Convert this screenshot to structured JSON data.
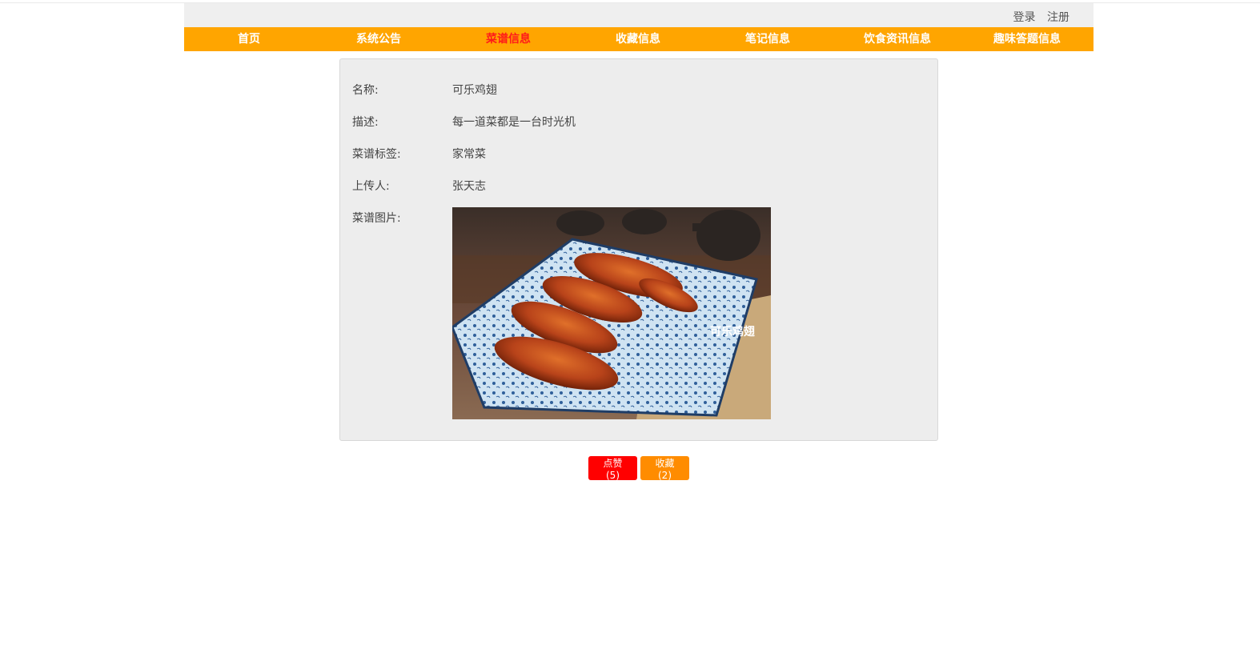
{
  "auth": {
    "login": "登录",
    "register": "注册"
  },
  "nav": {
    "items": [
      {
        "label": "首页"
      },
      {
        "label": "系统公告"
      },
      {
        "label": "菜谱信息"
      },
      {
        "label": "收藏信息"
      },
      {
        "label": "笔记信息"
      },
      {
        "label": "饮食资讯信息"
      },
      {
        "label": "趣味答题信息"
      }
    ],
    "active_index": 2,
    "active_color": "#ff1a1a",
    "bar_color": "#ffa500"
  },
  "detail": {
    "name_label": "名称:",
    "name_value": "可乐鸡翅",
    "desc_label": "描述:",
    "desc_value": "每一道菜都是一台时光机",
    "tag_label": "菜谱标签:",
    "tag_value": "家常菜",
    "uploader_label": "上传人:",
    "uploader_value": "张天志",
    "image_label": "菜谱图片:",
    "image_watermark": "可乐鸡翅"
  },
  "actions": {
    "like_label": "点赞(5)",
    "favorite_label": "收藏(2)",
    "like_color": "#ff0000",
    "favorite_color": "#ff8c00"
  }
}
